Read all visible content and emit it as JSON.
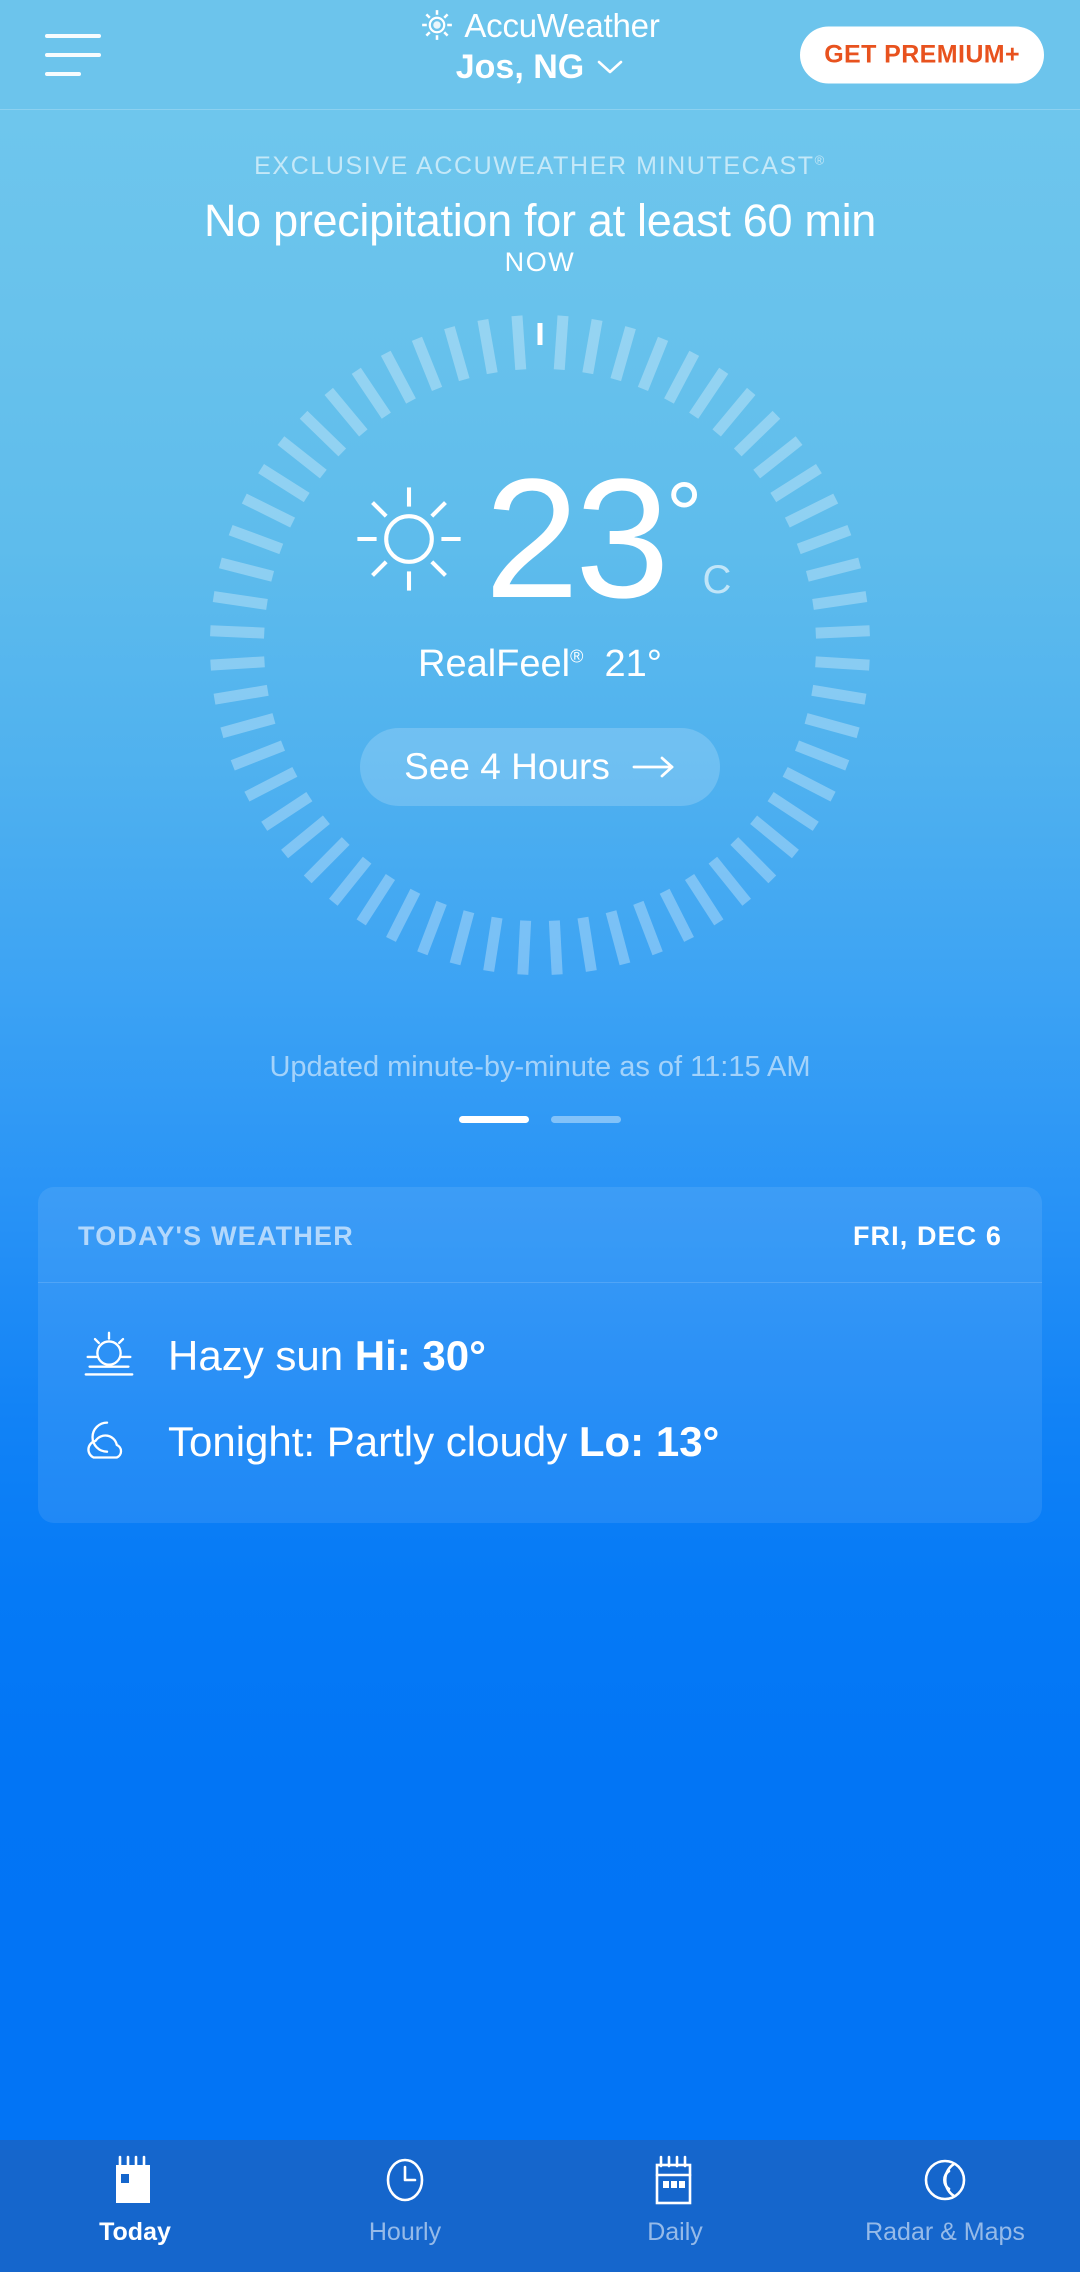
{
  "header": {
    "menu_icon": "hamburger-icon",
    "brand_logo_icon": "accuweather-sun-logo-icon",
    "brand": "AccuWeather",
    "location": "Jos, NG",
    "location_chevron_icon": "chevron-down-icon",
    "premium_label": "GET PREMIUM+"
  },
  "minutecast": {
    "label": "EXCLUSIVE ACCUWEATHER MINUTECAST",
    "label_mark": "®",
    "headline": "No precipitation for at least 60 min",
    "now_label": "NOW"
  },
  "current": {
    "condition_icon": "sun-icon",
    "temperature": "23",
    "degree": "°",
    "unit": "C",
    "realfeel_label": "RealFeel",
    "realfeel_mark": "®",
    "realfeel_value": "21°",
    "see_hours_label": "See 4 Hours",
    "see_hours_arrow_icon": "arrow-right-icon"
  },
  "updated_text": "Updated minute-by-minute as of 11:15 AM",
  "pager": {
    "total": 2,
    "active_index": 0
  },
  "today_card": {
    "title": "TODAY'S WEATHER",
    "date": "FRI, DEC 6",
    "rows": [
      {
        "icon": "hazy-sun-icon",
        "text": "Hazy sun ",
        "emphasis": "Hi: 30°"
      },
      {
        "icon": "partly-cloudy-night-icon",
        "text": "Tonight: Partly cloudy ",
        "emphasis": "Lo: 13°"
      }
    ]
  },
  "tabs": [
    {
      "label": "Today",
      "icon": "calendar-today-icon",
      "active": true
    },
    {
      "label": "Hourly",
      "icon": "clock-icon",
      "active": false
    },
    {
      "label": "Daily",
      "icon": "calendar-icon",
      "active": false
    },
    {
      "label": "Radar & Maps",
      "icon": "radar-icon",
      "active": false
    }
  ],
  "colors": {
    "sky_top": "#6ec6ed",
    "sky_bottom": "#0273f5",
    "accent_orange": "#e8521e",
    "tabbar": "#1566cc",
    "card": "rgba(255,255,255,0.09)"
  },
  "dial": {
    "tick_count": 60,
    "radius_outer": 330,
    "tick_length": 54,
    "tick_width": 11,
    "gap_degrees": 8
  }
}
